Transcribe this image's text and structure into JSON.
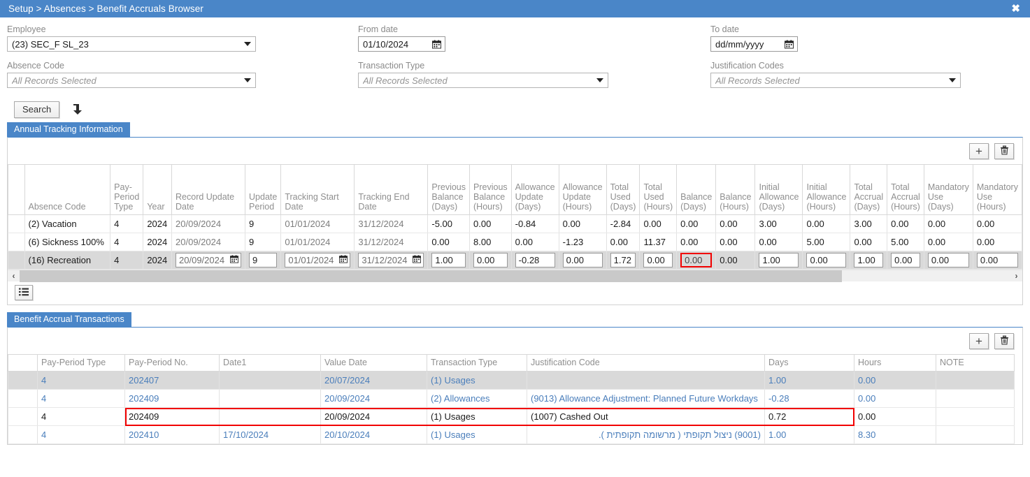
{
  "titlebar": {
    "breadcrumb": "Setup > Absences > Benefit Accruals Browser",
    "close_label": "✖"
  },
  "search_form": {
    "employee": {
      "label": "Employee",
      "value": "(23) SEC_F SL_23"
    },
    "from_date": {
      "label": "From date",
      "value": "01/10/2024"
    },
    "to_date": {
      "label": "To date",
      "value": "dd/mm/yyyy"
    },
    "absence_code": {
      "label": "Absence Code",
      "value": "All Records Selected"
    },
    "transaction_type": {
      "label": "Transaction Type",
      "value": "All Records Selected"
    },
    "justification_codes": {
      "label": "Justification Codes",
      "value": "All Records Selected"
    },
    "search_button": "Search"
  },
  "annual_panel": {
    "tab_label": "Annual Tracking Information",
    "add_label": "+",
    "delete_label": "🗑",
    "columns": [
      "",
      "Absence Code",
      "Pay-Period Type",
      "Year",
      "Record Update Date",
      "Update Period",
      "Tracking Start Date",
      "Tracking End Date",
      "Previous Balance (Days)",
      "Previous Balance (Hours)",
      "Allowance Update (Days)",
      "Allowance Update (Hours)",
      "Total Used (Days)",
      "Total Used (Hours)",
      "Balance (Days)",
      "Balance (Hours)",
      "Initial Allowance (Days)",
      "Initial Allowance (Hours)",
      "Total Accrual (Days)",
      "Total Accrual (Hours)",
      "Mandatory Use (Days)",
      "Mandatory Use (Hours)"
    ],
    "rows": [
      {
        "selected": false,
        "cells": [
          "",
          "(2) Vacation",
          "4",
          "2024",
          "20/09/2024",
          "9",
          "01/01/2024",
          "31/12/2024",
          "-5.00",
          "0.00",
          "-0.84",
          "0.00",
          "-2.84",
          "0.00",
          "0.00",
          "0.00",
          "3.00",
          "0.00",
          "3.00",
          "0.00",
          "0.00",
          "0.00"
        ]
      },
      {
        "selected": false,
        "cells": [
          "",
          "(6) Sickness 100%",
          "4",
          "2024",
          "20/09/2024",
          "9",
          "01/01/2024",
          "31/12/2024",
          "0.00",
          "8.00",
          "0.00",
          "-1.23",
          "0.00",
          "11.37",
          "0.00",
          "0.00",
          "0.00",
          "5.00",
          "0.00",
          "5.00",
          "0.00",
          "0.00"
        ]
      },
      {
        "selected": true,
        "cells": [
          "",
          "(16) Recreation",
          "4",
          "2024",
          "20/09/2024",
          "9",
          "01/01/2024",
          "31/12/2024",
          "1.00",
          "0.00",
          "-0.28",
          "0.00",
          "1.72",
          "0.00",
          "0.00",
          "0.00",
          "1.00",
          "0.00",
          "1.00",
          "0.00",
          "0.00",
          "0.00"
        ]
      }
    ],
    "highlighted_cell": {
      "row": 2,
      "column": "Balance (Days)",
      "value": "0.00"
    },
    "scroll_left_label": "‹",
    "scroll_right_label": "›"
  },
  "transactions_panel": {
    "tab_label": "Benefit Accrual Transactions",
    "add_label": "+",
    "delete_label": "🗑",
    "columns": [
      "",
      "Pay-Period Type",
      "Pay-Period No.",
      "Date1",
      "Value Date",
      "Transaction Type",
      "Justification Code",
      "Days",
      "Hours",
      "NOTE"
    ],
    "rows": [
      {
        "style": "selected",
        "cells": [
          "",
          "4",
          "202407",
          "",
          "20/07/2024",
          "(1) Usages",
          "",
          "1.00",
          "0.00",
          ""
        ]
      },
      {
        "style": "normal",
        "cells": [
          "",
          "4",
          "202409",
          "",
          "20/09/2024",
          "(2) Allowances",
          "(9013) Allowance Adjustment: Planned Future Workdays",
          "-0.28",
          "0.00",
          ""
        ]
      },
      {
        "style": "highlighted",
        "cells": [
          "",
          "4",
          "202409",
          "",
          "20/09/2024",
          "(1) Usages",
          "(1007) Cashed Out",
          "0.72",
          "0.00",
          ""
        ]
      },
      {
        "style": "normal",
        "rtl_justification": true,
        "cells": [
          "",
          "4",
          "202410",
          "17/10/2024",
          "20/10/2024",
          "(1) Usages",
          "(9001) ניצול תקופתי ( מרשומה תקופתית ).",
          "1.00",
          "8.30",
          ""
        ]
      }
    ]
  },
  "colors": {
    "accent": "#4a86c8",
    "highlight_red": "#f10000",
    "link_blue": "#4a7ebb",
    "row_selected": "#d9d9d9"
  }
}
